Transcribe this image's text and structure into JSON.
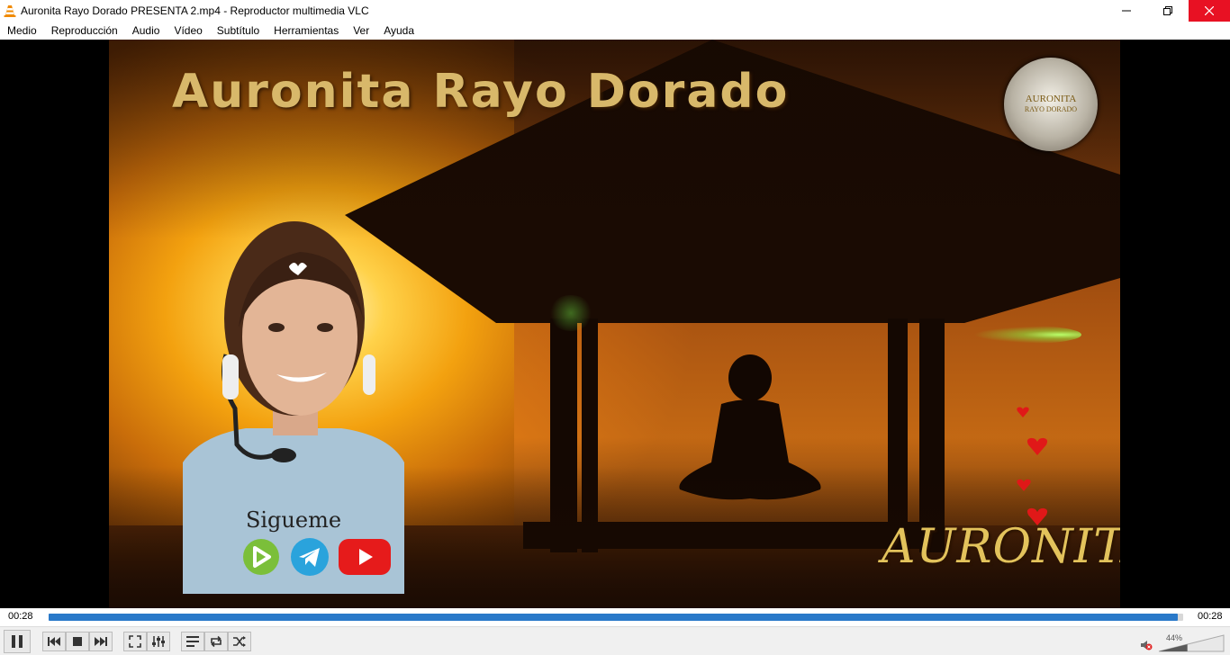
{
  "window": {
    "title": "Auronita Rayo Dorado PRESENTA 2.mp4 - Reproductor multimedia VLC",
    "app_icon": "vlc-cone-icon",
    "controls": [
      "minimize-icon",
      "restore-icon",
      "close-icon"
    ]
  },
  "menu": {
    "items": [
      "Medio",
      "Reproducción",
      "Audio",
      "Vídeo",
      "Subtítulo",
      "Herramientas",
      "Ver",
      "Ayuda"
    ]
  },
  "video": {
    "title_overlay": "Auronita Rayo Dorado",
    "logo_line1": "AURONITA",
    "logo_line2": "RAYO DORADO",
    "sigueme": "Sigueme",
    "signature": "AURONITA",
    "social_icons": [
      "rumble-icon",
      "telegram-icon",
      "youtube-icon"
    ]
  },
  "playback": {
    "elapsed": "00:28",
    "total": "00:28",
    "progress_fraction": 0.995,
    "volume": "44%",
    "volume_fraction": 0.44
  },
  "colors": {
    "accent": "#2979c9",
    "close_button": "#e81123"
  }
}
